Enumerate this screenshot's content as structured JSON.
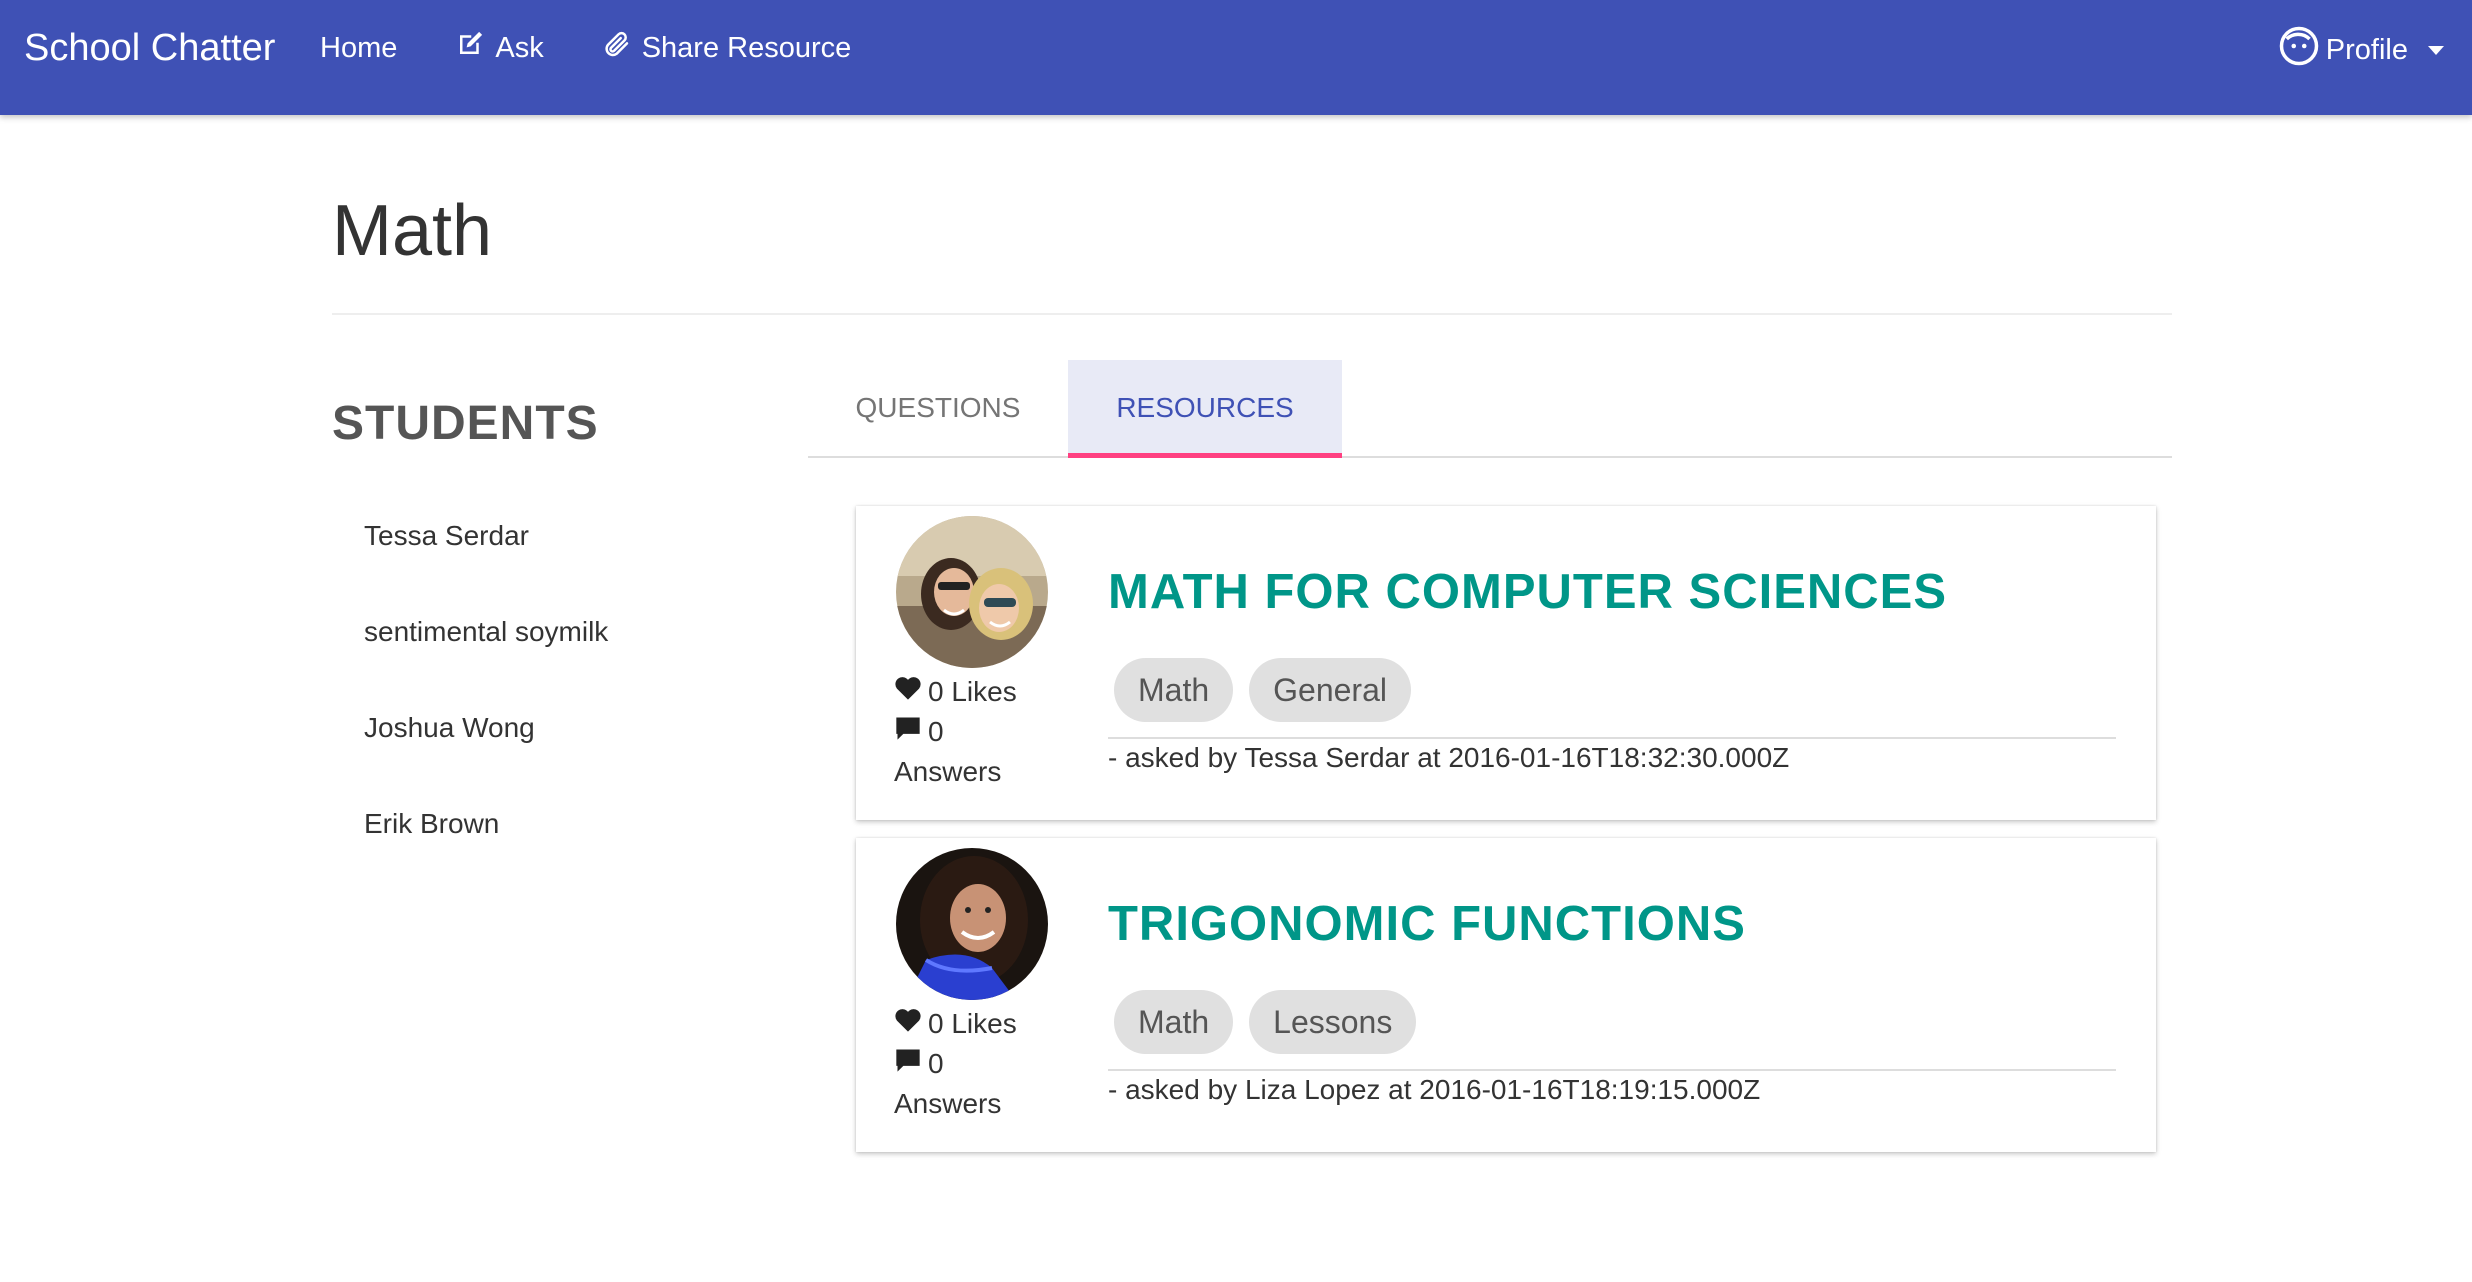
{
  "navbar": {
    "brand": "School Chatter",
    "links": [
      {
        "label": "Home",
        "icon": ""
      },
      {
        "label": "Ask",
        "icon": "edit-icon"
      },
      {
        "label": "Share Resource",
        "icon": "paperclip-icon"
      }
    ],
    "profile_label": "Profile",
    "bg_color": "#3f51b5"
  },
  "page": {
    "title": "Math"
  },
  "students": {
    "heading": "STUDENTS",
    "items": [
      "Tessa Serdar",
      "sentimental soymilk",
      "Joshua Wong",
      "Erik Brown"
    ]
  },
  "tabs": {
    "items": [
      "QUESTIONS",
      "RESOURCES"
    ],
    "active": "RESOURCES",
    "accent_color": "#ff4081"
  },
  "resources": [
    {
      "title": "MATH FOR COMPUTER SCIENCES",
      "tags": [
        "Math",
        "General"
      ],
      "likes_text": "0 Likes",
      "answers_count": "0",
      "answers_label": "Answers",
      "meta": "- asked by Tessa Serdar at 2016-01-16T18:32:30.000Z"
    },
    {
      "title": "TRIGONOMIC FUNCTIONS",
      "tags": [
        "Math",
        "Lessons"
      ],
      "likes_text": "0 Likes",
      "answers_count": "0",
      "answers_label": "Answers",
      "meta": "- asked by Liza Lopez at 2016-01-16T18:19:15.000Z"
    }
  ],
  "colors": {
    "title_teal": "#009688",
    "chip_bg": "#e0e0e0"
  }
}
